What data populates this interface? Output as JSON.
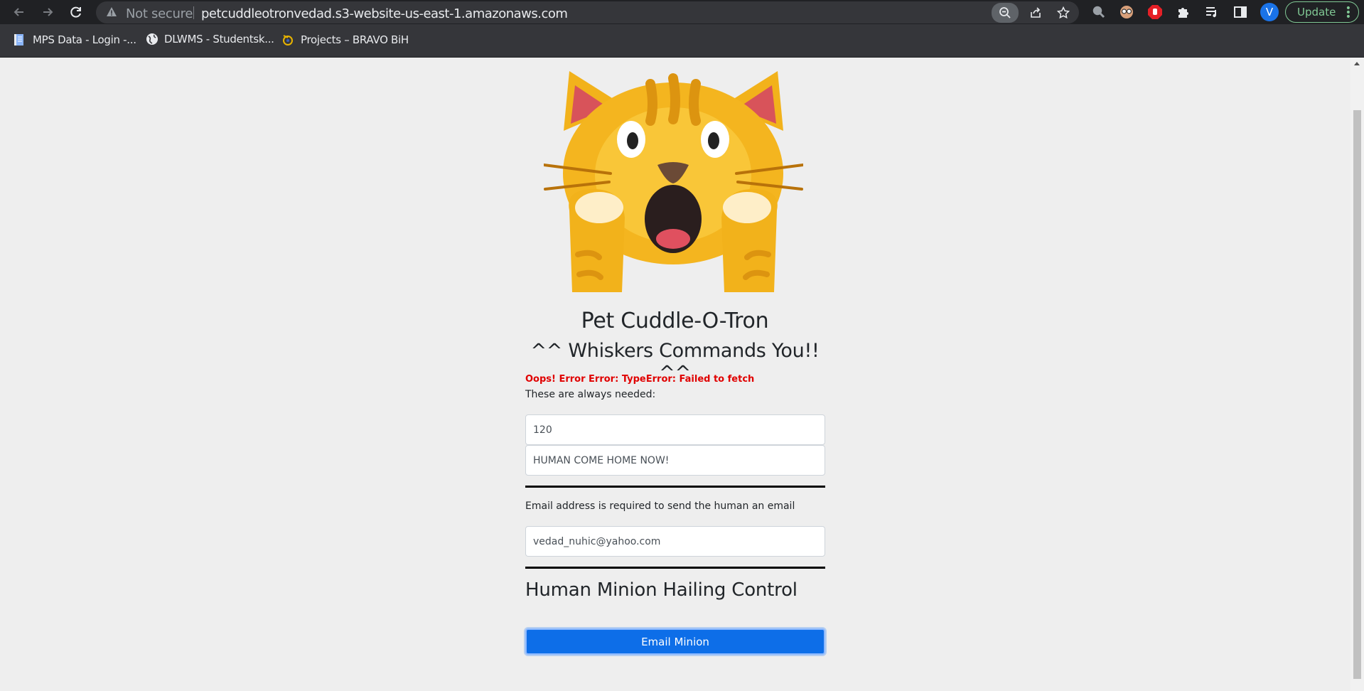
{
  "browser": {
    "security_label": "Not secure",
    "url": "petcuddleotronvedad.s3-website-us-east-1.amazonaws.com",
    "profile_initial": "V",
    "update_label": "Update",
    "bookmarks": [
      {
        "label": "MPS Data - Login -..."
      },
      {
        "label": "DLWMS - Studentsk..."
      },
      {
        "label": "Projects – BRAVO BiH"
      }
    ]
  },
  "page": {
    "title": "Pet Cuddle-O-Tron",
    "subtitle": "^^ Whiskers Commands You!! ^^",
    "error_message": "Oops! Error Error: TypeError: Failed to fetch",
    "always_needed_text": "These are always needed:",
    "fields": {
      "wait_value": "120",
      "message_value": "HUMAN COME HOME NOW!",
      "email_value": "vedad_nuhic@yahoo.com"
    },
    "email_label": "Email address is required to send the human an email",
    "section_heading": "Human Minion Hailing Control",
    "submit_label": "Email Minion"
  },
  "colors": {
    "error": "#e00000",
    "primary_button": "#0d6ee8",
    "page_bg": "#eeeeee"
  }
}
